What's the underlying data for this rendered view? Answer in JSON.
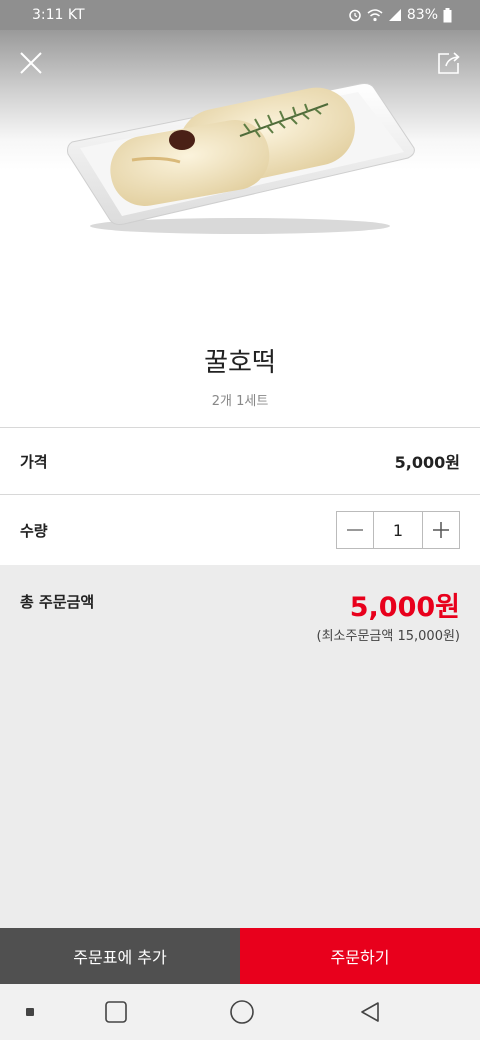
{
  "status_bar": {
    "time": "3:11",
    "carrier": "KT",
    "battery": "83%",
    "icons": [
      "alarm-icon",
      "wifi-icon",
      "signal-icon",
      "battery-icon"
    ]
  },
  "header": {
    "close_icon": "close-icon",
    "share_icon": "share-icon"
  },
  "product": {
    "name": "꿀호떡",
    "description": "2개 1세트"
  },
  "price_row": {
    "label": "가격",
    "value": "5,000원"
  },
  "quantity_row": {
    "label": "수량",
    "value": "1",
    "decrease_icon": "minus-icon",
    "increase_icon": "plus-icon"
  },
  "total": {
    "label": "총 주문금액",
    "amount": "5,000원",
    "minimum_note": "(최소주문금액 15,000원)"
  },
  "actions": {
    "add_to_cart": "주문표에 추가",
    "order": "주문하기"
  },
  "nav_bar": {
    "icons": [
      "recent-apps-icon",
      "home-icon",
      "back-icon",
      "dot-icon"
    ]
  },
  "colors": {
    "accent": "#e8001c",
    "secondary_button": "#505050",
    "background": "#ececec"
  }
}
